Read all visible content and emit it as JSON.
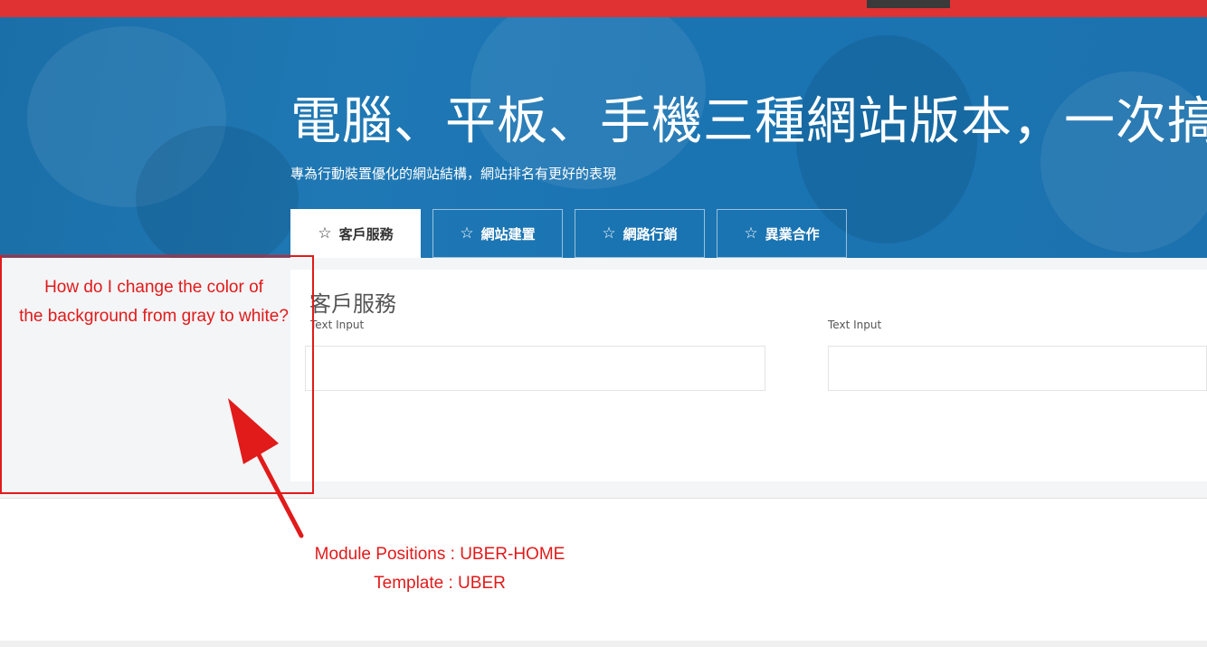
{
  "hero": {
    "title": "電腦、平板、手機三種網站版本，一次搞定",
    "subtitle": "專為行動裝置優化的網站結構，網站排名有更好的表現"
  },
  "tabs": [
    {
      "icon": "star-outline-icon",
      "glyph": "☆",
      "label": "客戶服務",
      "active": true
    },
    {
      "icon": "star-outline-icon",
      "glyph": "☆",
      "label": "網站建置",
      "active": false
    },
    {
      "icon": "star-outline-icon",
      "glyph": "☆",
      "label": "網路行銷",
      "active": false
    },
    {
      "icon": "star-outline-icon",
      "glyph": "☆",
      "label": "異業合作",
      "active": false
    }
  ],
  "section": {
    "heading": "客戶服務",
    "fields": [
      {
        "label": "Text Input",
        "value": ""
      },
      {
        "label": "Text Input",
        "value": ""
      }
    ]
  },
  "annotation": {
    "question_line1": "How do I change the color of",
    "question_line2": "the background from gray to white?",
    "note_line1": "Module Positions : UBER-HOME",
    "note_line2": "Template : UBER"
  },
  "colors": {
    "topbar": "#e03133",
    "hero": "#1c72ae",
    "gray_background": "#f4f5f7",
    "annotation": "#e11a1a"
  }
}
